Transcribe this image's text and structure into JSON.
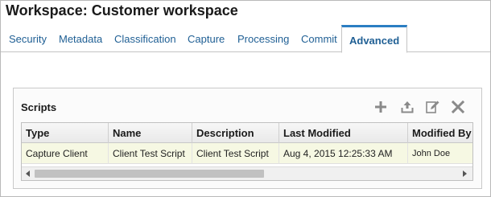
{
  "header": {
    "title": "Workspace: Customer workspace"
  },
  "tabs": [
    {
      "label": "Security"
    },
    {
      "label": "Metadata"
    },
    {
      "label": "Classification"
    },
    {
      "label": "Capture"
    },
    {
      "label": "Processing"
    },
    {
      "label": "Commit"
    },
    {
      "label": "Advanced",
      "active": true
    }
  ],
  "scripts_panel": {
    "title": "Scripts",
    "toolbar": [
      "add-icon",
      "upload-icon",
      "edit-icon",
      "delete-icon"
    ],
    "columns": [
      "Type",
      "Name",
      "Description",
      "Last Modified",
      "Modified By"
    ],
    "rows": [
      {
        "type": "Capture Client",
        "name": "Client Test Script",
        "description": "Client Test Script",
        "last_modified": "Aug 4, 2015 12:25:33 AM",
        "modified_by": "John Doe"
      }
    ]
  },
  "colors": {
    "accent": "#2b7ec2",
    "tab_text": "#1f5f94",
    "selected_row": "#f6f8e3"
  }
}
